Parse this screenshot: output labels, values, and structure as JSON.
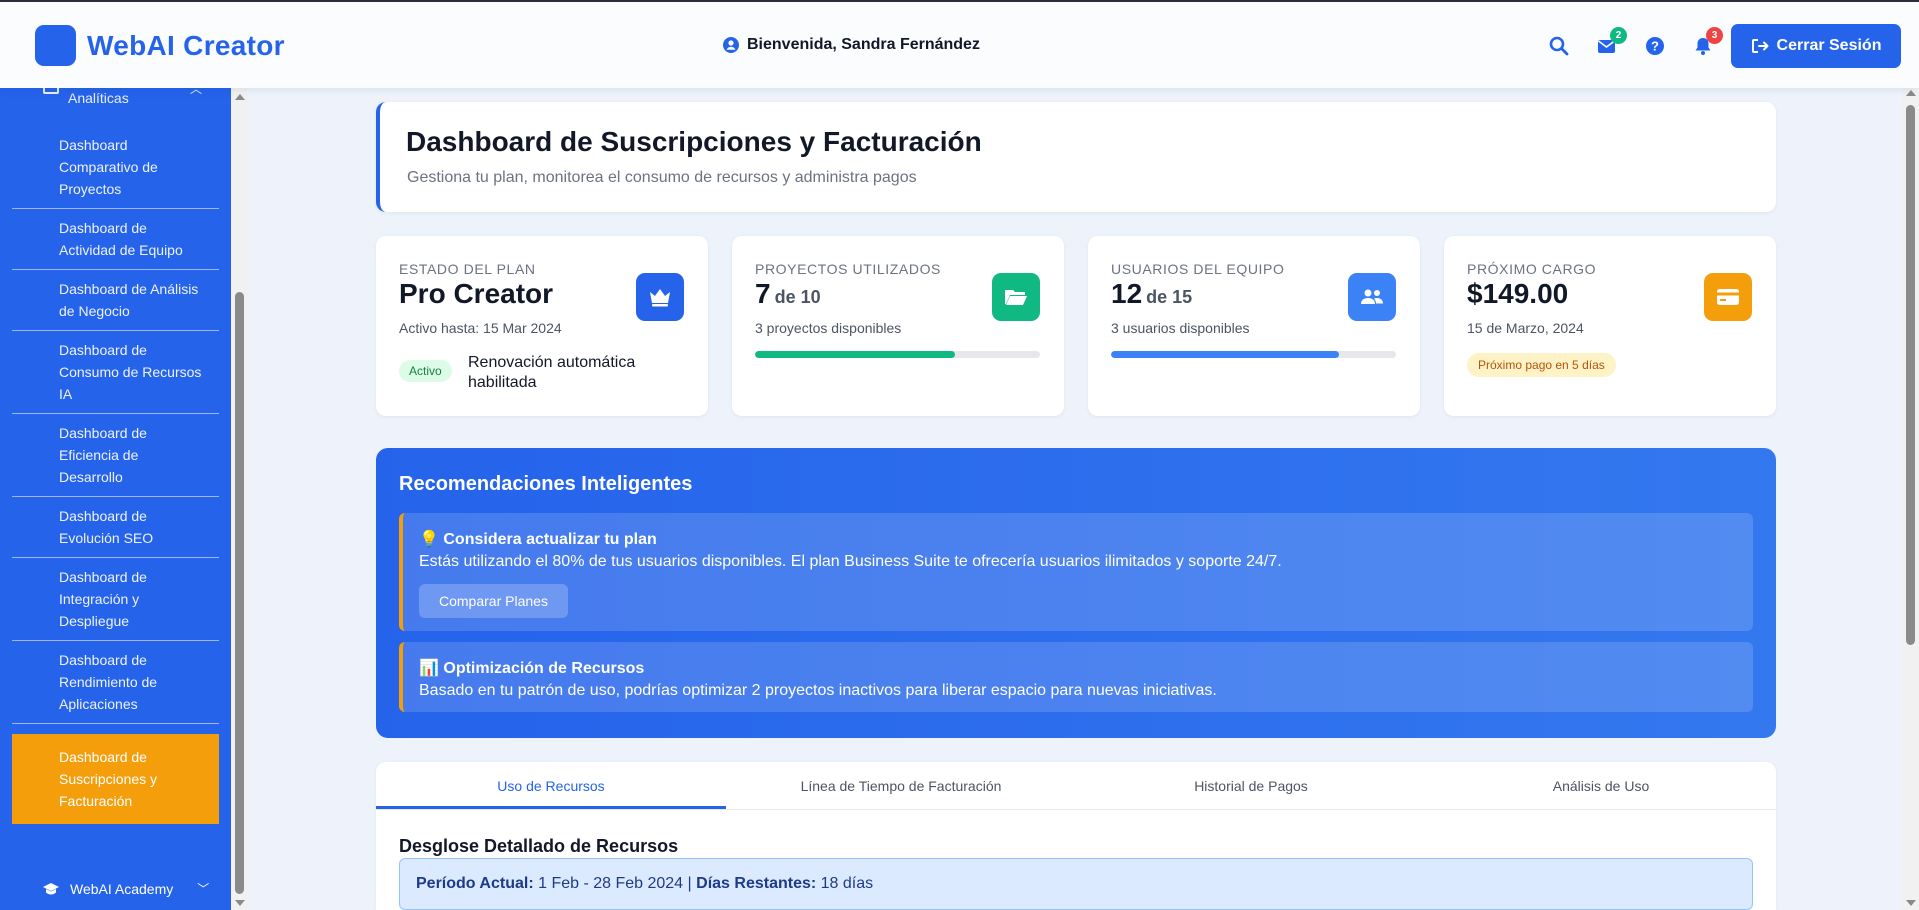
{
  "header": {
    "brand": "WebAI Creator",
    "welcome": "Bienvenida, Sandra Fernández",
    "messages_count": "2",
    "notifications_count": "3",
    "logout_label": "Cerrar Sesión"
  },
  "sidebar": {
    "partial_group": "Analíticas",
    "items": [
      {
        "label": "Dashboard Comparativo de Proyectos"
      },
      {
        "label": "Dashboard de Actividad de Equipo"
      },
      {
        "label": "Dashboard de Análisis de Negocio"
      },
      {
        "label": "Dashboard de Consumo de Recursos IA"
      },
      {
        "label": "Dashboard de Eficiencia de Desarrollo"
      },
      {
        "label": "Dashboard de Evolución SEO"
      },
      {
        "label": "Dashboard de Integración y Despliegue"
      },
      {
        "label": "Dashboard de Rendimiento de Aplicaciones"
      },
      {
        "label": "Dashboard de Suscripciones y Facturación",
        "active": true
      }
    ],
    "academy_label": "WebAI Academy"
  },
  "page": {
    "title": "Dashboard de Suscripciones y Facturación",
    "subtitle": "Gestiona tu plan, monitorea el consumo de recursos y administra pagos"
  },
  "stats": {
    "plan": {
      "label": "ESTADO DEL PLAN",
      "value": "Pro Creator",
      "sub": "Activo hasta: 15 Mar 2024",
      "status_badge": "Activo",
      "renewal": "Renovación automática habilitada",
      "icon": "crown-icon",
      "color": "#2563eb"
    },
    "projects": {
      "label": "PROYECTOS UTILIZADOS",
      "value": "7",
      "of": "de 10",
      "sub": "3 proyectos disponibles",
      "progress": 0.7,
      "icon": "folder-icon",
      "color": "#10b981"
    },
    "users": {
      "label": "USUARIOS DEL EQUIPO",
      "value": "12",
      "of": "de 15",
      "sub": "3 usuarios disponibles",
      "progress": 0.8,
      "icon": "users-icon",
      "color": "#3b82f6"
    },
    "charge": {
      "label": "PRÓXIMO CARGO",
      "value": "$149.00",
      "sub": "15 de Marzo, 2024",
      "badge": "Próximo pago en 5 días",
      "icon": "credit-card-icon",
      "color": "#f59e0b"
    }
  },
  "recommendations": {
    "title": "Recomendaciones Inteligentes",
    "items": [
      {
        "emoji": "💡",
        "title": "Considera actualizar tu plan",
        "text": "Estás utilizando el 80% de tus usuarios disponibles. El plan Business Suite te ofrecería usuarios ilimitados y soporte 24/7.",
        "button": "Comparar Planes"
      },
      {
        "emoji": "📊",
        "title": "Optimización de Recursos",
        "text": "Basado en tu patrón de uso, podrías optimizar 2 proyectos inactivos para liberar espacio para nuevas iniciativas."
      }
    ]
  },
  "tabs": {
    "items": [
      {
        "label": "Uso de Recursos",
        "active": true
      },
      {
        "label": "Línea de Tiempo de Facturación"
      },
      {
        "label": "Historial de Pagos"
      },
      {
        "label": "Análisis de Uso"
      }
    ]
  },
  "resources": {
    "title": "Desglose Detallado de Recursos",
    "period_label": "Período Actual:",
    "period_value": "1 Feb - 28 Feb 2024",
    "separator": "|",
    "days_label": "Días Restantes:",
    "days_value": "18 días"
  }
}
